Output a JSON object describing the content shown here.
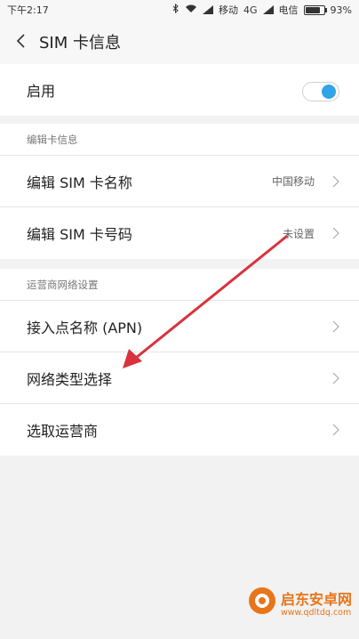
{
  "status_bar": {
    "time": "下午2:17",
    "carrier1": "移动",
    "network": "4G",
    "carrier2": "电信",
    "battery": "93%",
    "battery_level": 0.93
  },
  "header": {
    "title": "SIM 卡信息"
  },
  "enable": {
    "label": "启用",
    "on": true
  },
  "edit_section": {
    "header": "编辑卡信息",
    "items": [
      {
        "label": "编辑 SIM 卡名称",
        "value": "中国移动"
      },
      {
        "label": "编辑 SIM 卡号码",
        "value": "未设置"
      }
    ]
  },
  "network_section": {
    "header": "运营商网络设置",
    "items": [
      {
        "label": "接入点名称 (APN)"
      },
      {
        "label": "网络类型选择"
      },
      {
        "label": "选取运营商"
      }
    ]
  },
  "watermark": {
    "text": "启东安卓网",
    "url": "www.qdltdq.com"
  },
  "colors": {
    "accent": "#32a4e8",
    "arrow": "#d8323c",
    "watermark": "#e8751a"
  }
}
